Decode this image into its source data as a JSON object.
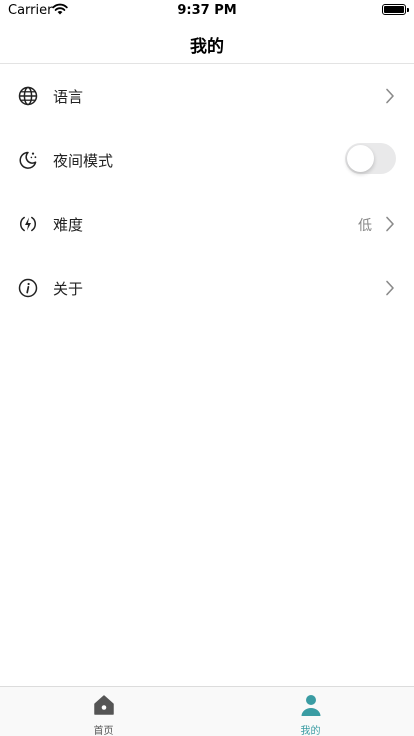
{
  "status_bar": {
    "carrier": "Carrier",
    "time": "9:37 PM"
  },
  "nav": {
    "title": "我的"
  },
  "settings": {
    "language": {
      "label": "语言"
    },
    "night_mode": {
      "label": "夜间模式",
      "enabled": false
    },
    "difficulty": {
      "label": "难度",
      "value": "低"
    },
    "about": {
      "label": "关于"
    }
  },
  "tabs": {
    "home": {
      "label": "首页",
      "active": false
    },
    "me": {
      "label": "我的",
      "active": true
    }
  },
  "colors": {
    "accent": "#3a9ca3",
    "inactive": "#555555",
    "toggle_off": "#e9e9ea"
  }
}
